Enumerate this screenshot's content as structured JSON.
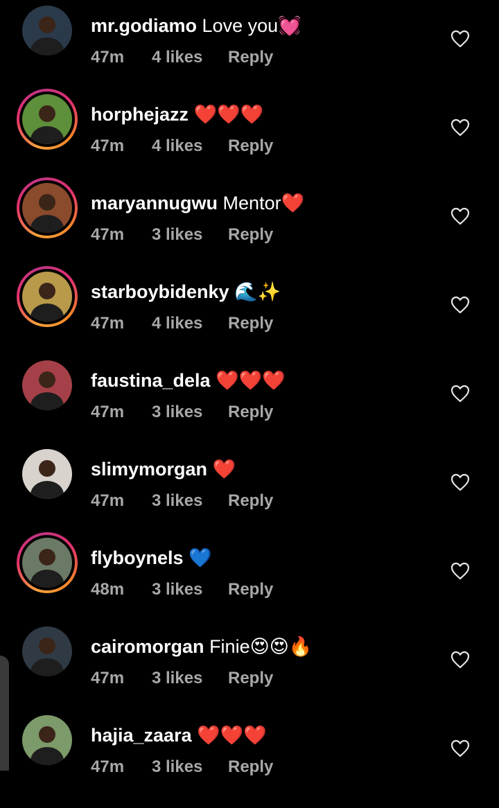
{
  "comments": [
    {
      "username": "mr.godiamo",
      "text": "Love you",
      "emojis": "💓",
      "time": "47m",
      "likes": "4 likes",
      "reply": "Reply",
      "story_ring": false,
      "avatar_color": "#2b3a4a"
    },
    {
      "username": "horphejazz",
      "text": "",
      "emojis": "❤️❤️❤️",
      "time": "47m",
      "likes": "4 likes",
      "reply": "Reply",
      "story_ring": true,
      "avatar_color": "#5e8f3a"
    },
    {
      "username": "maryannugwu",
      "text": "Mentor",
      "emojis": "❤️",
      "time": "47m",
      "likes": "3 likes",
      "reply": "Reply",
      "story_ring": true,
      "avatar_color": "#8a4a2c"
    },
    {
      "username": "starboybidenky",
      "text": "",
      "emojis": "🌊✨",
      "time": "47m",
      "likes": "4 likes",
      "reply": "Reply",
      "story_ring": true,
      "avatar_color": "#b89a4a"
    },
    {
      "username": "faustina_dela",
      "text": "",
      "emojis": "❤️❤️❤️",
      "time": "47m",
      "likes": "3 likes",
      "reply": "Reply",
      "story_ring": false,
      "avatar_color": "#a54048"
    },
    {
      "username": "slimymorgan",
      "text": "",
      "emojis": "❤️",
      "time": "47m",
      "likes": "3 likes",
      "reply": "Reply",
      "story_ring": false,
      "avatar_color": "#d8d3cc"
    },
    {
      "username": "flyboynels",
      "text": "",
      "emojis": "💙",
      "time": "48m",
      "likes": "3 likes",
      "reply": "Reply",
      "story_ring": true,
      "avatar_color": "#6b7a66"
    },
    {
      "username": "cairomorgan",
      "text": "Finie",
      "emojis": "😍😍🔥",
      "time": "47m",
      "likes": "3 likes",
      "reply": "Reply",
      "story_ring": false,
      "avatar_color": "#2f3a44"
    },
    {
      "username": "hajia_zaara",
      "text": "",
      "emojis": "❤️❤️❤️",
      "time": "47m",
      "likes": "3 likes",
      "reply": "Reply",
      "story_ring": false,
      "avatar_color": "#7d9a6a"
    }
  ],
  "icons": {
    "like": "heart-outline-icon"
  },
  "colors": {
    "background": "#000000",
    "meta_text": "#a8a8a8",
    "heart_red": "#e0202e"
  }
}
